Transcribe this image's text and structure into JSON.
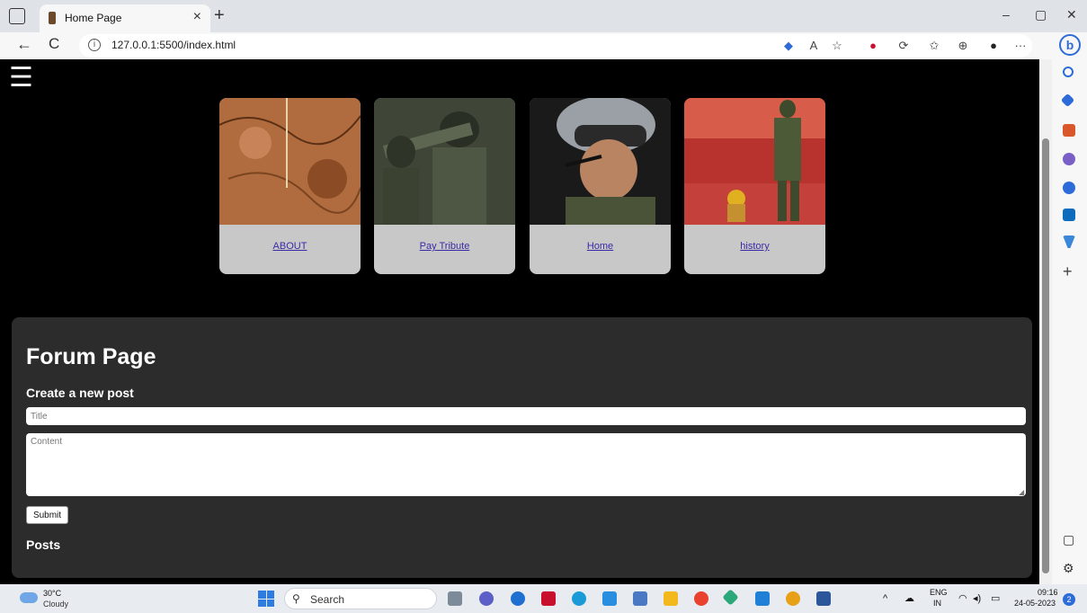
{
  "browser": {
    "tab_title": "Home Page",
    "tab_close": "×",
    "new_tab": "+",
    "url": "127.0.0.1:5500/index.html",
    "window_controls": {
      "minimize": "–",
      "restore": "▢",
      "close": "✕"
    },
    "back": "←",
    "reload": "C",
    "more": "···"
  },
  "page": {
    "menu_glyph": "☰",
    "cards": [
      {
        "label": "ABOUT",
        "image": "map-image"
      },
      {
        "label": "Pay Tribute",
        "image": "soldiers-image"
      },
      {
        "label": "Home",
        "image": "pilot-image"
      },
      {
        "label": "history",
        "image": "guard-image"
      }
    ],
    "forum": {
      "title": "Forum Page",
      "create_heading": "Create a new post",
      "title_placeholder": "Title",
      "content_placeholder": "Content",
      "submit_label": "Submit",
      "posts_heading": "Posts"
    }
  },
  "taskbar": {
    "weather_temp": "30°C",
    "weather_desc": "Cloudy",
    "search_placeholder": "Search",
    "lang_top": "ENG",
    "lang_bottom": "IN",
    "time": "09:16",
    "date": "24-05-2023",
    "notification_count": "2"
  },
  "colors": {
    "page_bg": "#000000",
    "card_bg": "#c8c8c8",
    "forum_bg": "#2c2c2c",
    "link": "#3a2aa6",
    "accent": "#2c6bd8"
  }
}
